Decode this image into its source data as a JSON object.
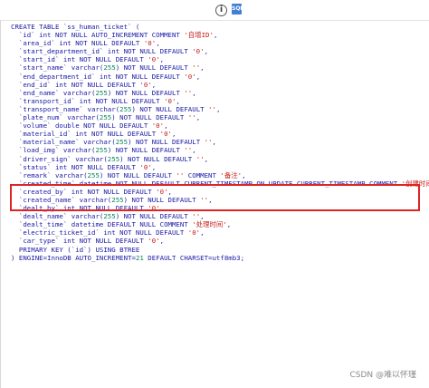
{
  "toolbar": {
    "info_icon": "i",
    "code_icon": "SQL"
  },
  "sql_lines": [
    "CREATE TABLE `ss_human_ticket` (",
    "  `id` int NOT NULL AUTO_INCREMENT COMMENT '自增ID',",
    "  `area_id` int NOT NULL DEFAULT '0',",
    "  `start_department_id` int NOT NULL DEFAULT '0',",
    "  `start_id` int NOT NULL DEFAULT '0',",
    "  `start_name` varchar(255) NOT NULL DEFAULT '',",
    "  `end_department_id` int NOT NULL DEFAULT '0',",
    "  `end_id` int NOT NULL DEFAULT '0',",
    "  `end_name` varchar(255) NOT NULL DEFAULT '',",
    "  `transport_id` int NOT NULL DEFAULT '0',",
    "  `transport_name` varchar(255) NOT NULL DEFAULT '',",
    "  `plate_num` varchar(255) NOT NULL DEFAULT '',",
    "  `volume` double NOT NULL DEFAULT '0',",
    "  `material_id` int NOT NULL DEFAULT '0',",
    "  `material_name` varchar(255) NOT NULL DEFAULT '',",
    "  `load_img` varchar(255) NOT NULL DEFAULT '',",
    "  `driver_sign` varchar(255) NOT NULL DEFAULT '',",
    "  `status` int NOT NULL DEFAULT '0',",
    "  `remark` varchar(255) NOT NULL DEFAULT '' COMMENT '备注',",
    "  `created_time` datetime NOT NULL DEFAULT CURRENT_TIMESTAMP ON UPDATE CURRENT_TIMESTAMP COMMENT '创建时间',",
    "  `created_by` int NOT NULL DEFAULT '0',",
    "  `created_name` varchar(255) NOT NULL DEFAULT '',",
    "  `dealt_by` int NOT NULL DEFAULT '0',",
    "  `dealt_name` varchar(255) NOT NULL DEFAULT '',",
    "  `dealt_time` datetime DEFAULT NULL COMMENT '处理时间',",
    "  `electric_ticket_id` int NOT NULL DEFAULT '0',",
    "  `car_type` int NOT NULL DEFAULT '0',",
    "  PRIMARY KEY (`id`) USING BTREE",
    ") ENGINE=InnoDB AUTO_INCREMENT=21 DEFAULT CHARSET=utf8mb3;"
  ],
  "watermark": "CSDN @难以怀瑾"
}
